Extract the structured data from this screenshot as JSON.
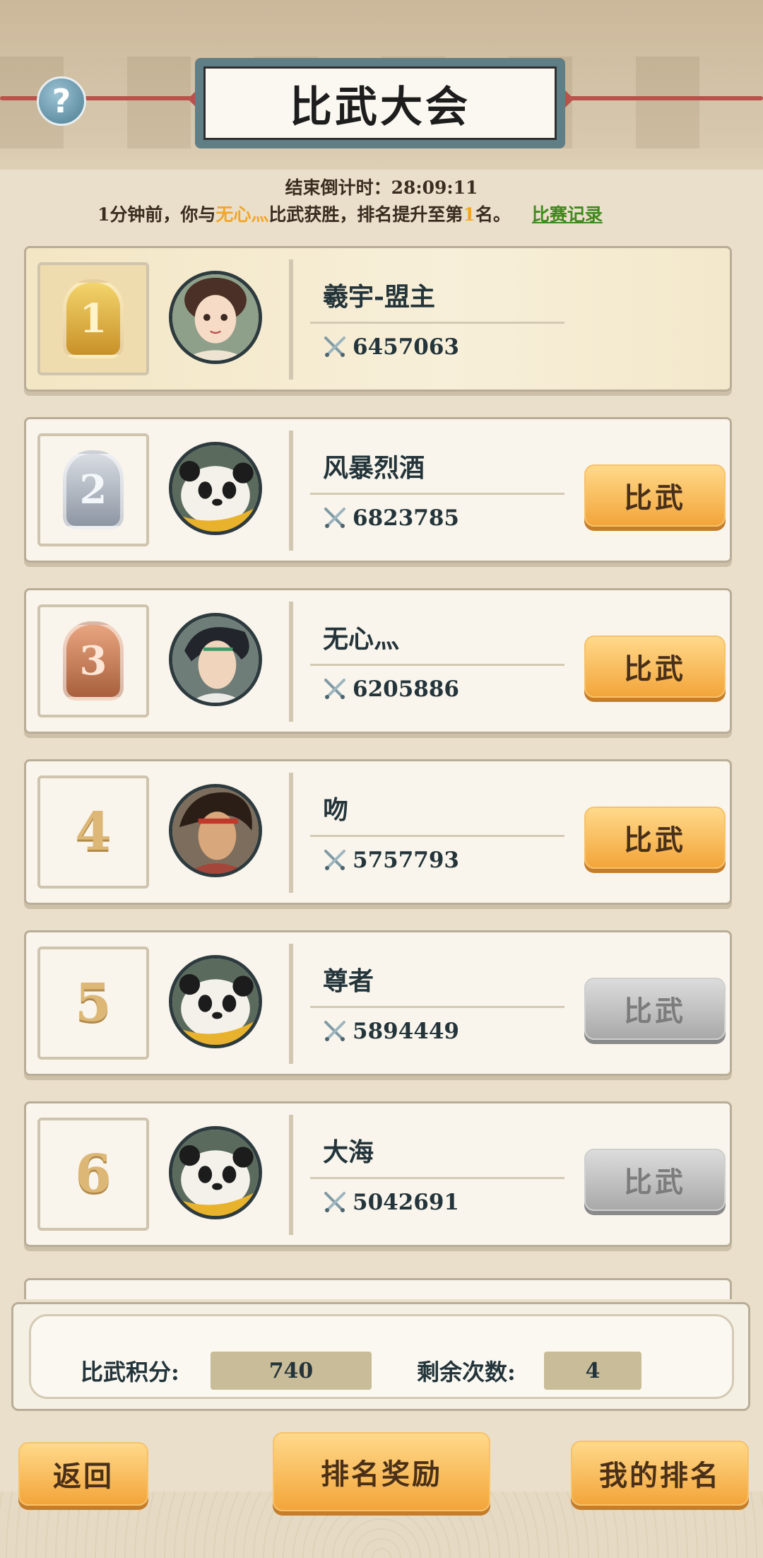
{
  "header": {
    "title": "比武大会",
    "help_symbol": "?"
  },
  "countdown": {
    "label": "结束倒计时：",
    "value": "28:09:11"
  },
  "notice": {
    "prefix": "1分钟前，你与",
    "opponent": "无心灬",
    "middle": "比武获胜，排名提升至第",
    "rank": "1",
    "suffix": "名。",
    "record_link": "比赛记录"
  },
  "rankings": [
    {
      "rank": "1",
      "name": "羲宇-盟主",
      "power": "6457063",
      "button": null,
      "badge": "gold",
      "avatar": "girl"
    },
    {
      "rank": "2",
      "name": "风暴烈酒",
      "power": "6823785",
      "button": "比武",
      "button_state": "active",
      "badge": "silver",
      "avatar": "panda"
    },
    {
      "rank": "3",
      "name": "无心灬",
      "power": "6205886",
      "button": "比武",
      "button_state": "active",
      "badge": "bronze",
      "avatar": "swordsman"
    },
    {
      "rank": "4",
      "name": "吻",
      "power": "5757793",
      "button": "比武",
      "button_state": "active",
      "badge": null,
      "avatar": "warrior"
    },
    {
      "rank": "5",
      "name": "尊者",
      "power": "5894449",
      "button": "比武",
      "button_state": "disabled",
      "badge": null,
      "avatar": "panda"
    },
    {
      "rank": "6",
      "name": "大海",
      "power": "5042691",
      "button": "比武",
      "button_state": "disabled",
      "badge": null,
      "avatar": "panda"
    }
  ],
  "stats": {
    "points_label": "比武积分:",
    "points_value": "740",
    "remaining_label": "剩余次数:",
    "remaining_value": "4"
  },
  "footer": {
    "back_label": "返回",
    "rewards_label": "排名奖励",
    "my_rank_label": "我的排名"
  },
  "colors": {
    "accent_orange": "#f3a53a",
    "highlight_yellow": "#f2a627",
    "link_green": "#3e8a1e",
    "disabled_gray": "#a9a9a9"
  }
}
